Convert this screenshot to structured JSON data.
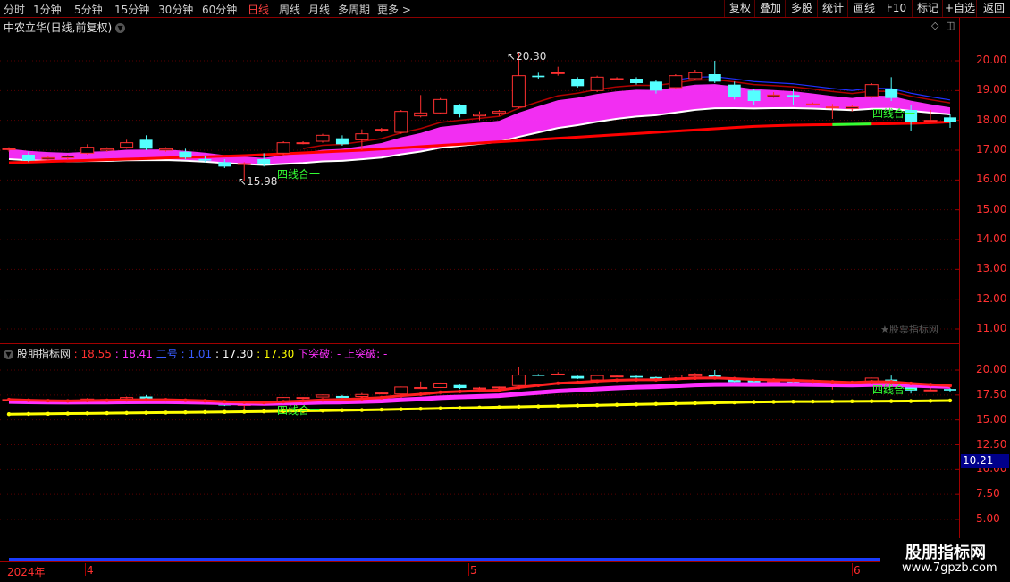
{
  "toolbar": {
    "periods": [
      "分时",
      "1分钟",
      "5分钟",
      "15分钟",
      "30分钟",
      "60分钟",
      "日线",
      "周线",
      "月线",
      "多周期",
      "更多 >"
    ],
    "active_period": "日线",
    "buttons": [
      "复权",
      "叠加",
      "多股",
      "统计",
      "画线",
      "F10",
      "标记",
      "+自选",
      "返回"
    ]
  },
  "main_panel": {
    "title": "中农立华(日线,前复权)",
    "high_label": "20.30",
    "low_label": "15.98",
    "annotation1": "四线合一",
    "annotation2": "四线合一",
    "watermark": "★股票指标网",
    "y_ticks": [
      "20.00",
      "19.00",
      "18.00",
      "17.00",
      "16.00",
      "15.00",
      "14.00",
      "13.00",
      "12.00",
      "11.00"
    ]
  },
  "sub_panel": {
    "name": "股朋指标网",
    "v1": ": 18.55",
    "v2": ": 18.41",
    "v3_label": "二号",
    "v3": ": 1.01",
    "v4": ": 17.30",
    "v5": ": 17.30",
    "down_break": "下突破: -",
    "up_break": "上突破: -",
    "annotation1": "四线合一",
    "annotation2": "四线合一",
    "y_ticks": [
      "20.00",
      "17.50",
      "15.00",
      "12.50",
      "10.00",
      "7.50",
      "5.00"
    ],
    "value_box": "10.21"
  },
  "time_axis": {
    "labels": [
      "2024年",
      "4",
      "5",
      "6"
    ]
  },
  "brand": {
    "name": "股朋指标网",
    "url": "www.7gpzb.com"
  },
  "colors": {
    "up": "#ff3030",
    "down": "#54ffff",
    "ma_long": "#ff0000",
    "band": "#ff30ff",
    "white_line": "#ffffff",
    "yellow_line": "#ffff00",
    "accent_green": "#33ff33"
  },
  "chart_data": {
    "type": "candlestick",
    "title": "中农立华(日线,前复权)",
    "ylim": [
      10.5,
      20.6
    ],
    "candles": [
      [
        17.05,
        17.1,
        16.95,
        17.05
      ],
      [
        16.85,
        16.95,
        16.6,
        16.65
      ],
      [
        16.7,
        16.8,
        16.65,
        16.75
      ],
      [
        16.75,
        16.85,
        16.7,
        16.8
      ],
      [
        16.9,
        17.2,
        16.85,
        17.1
      ],
      [
        17.0,
        17.1,
        16.95,
        17.05
      ],
      [
        17.1,
        17.35,
        17.05,
        17.25
      ],
      [
        17.35,
        17.5,
        17.0,
        17.05
      ],
      [
        17.0,
        17.1,
        16.95,
        17.05
      ],
      [
        16.95,
        17.05,
        16.7,
        16.75
      ],
      [
        16.7,
        16.8,
        16.6,
        16.65
      ],
      [
        16.6,
        16.7,
        16.4,
        16.45
      ],
      [
        16.55,
        16.6,
        15.98,
        16.55
      ],
      [
        16.7,
        16.9,
        16.45,
        16.55
      ],
      [
        16.9,
        17.3,
        16.8,
        17.25
      ],
      [
        17.25,
        17.3,
        17.2,
        17.25
      ],
      [
        17.3,
        17.55,
        17.25,
        17.5
      ],
      [
        17.4,
        17.5,
        17.15,
        17.2
      ],
      [
        17.35,
        17.7,
        17.0,
        17.55
      ],
      [
        17.7,
        17.75,
        17.6,
        17.7
      ],
      [
        17.6,
        18.35,
        17.55,
        18.3
      ],
      [
        18.15,
        18.85,
        18.1,
        18.25
      ],
      [
        18.25,
        18.75,
        18.2,
        18.7
      ],
      [
        18.5,
        18.55,
        18.1,
        18.2
      ],
      [
        18.15,
        18.3,
        18.0,
        18.2
      ],
      [
        18.25,
        18.35,
        18.15,
        18.3
      ],
      [
        18.45,
        20.3,
        18.4,
        19.5
      ],
      [
        19.5,
        19.6,
        19.4,
        19.45
      ],
      [
        19.6,
        19.8,
        19.5,
        19.6
      ],
      [
        19.4,
        19.45,
        19.1,
        19.15
      ],
      [
        19.0,
        19.5,
        18.95,
        19.45
      ],
      [
        19.4,
        19.45,
        19.35,
        19.4
      ],
      [
        19.4,
        19.45,
        19.2,
        19.25
      ],
      [
        19.3,
        19.35,
        18.9,
        19.0
      ],
      [
        19.1,
        19.55,
        19.05,
        19.5
      ],
      [
        19.4,
        19.7,
        19.35,
        19.6
      ],
      [
        19.55,
        20.0,
        19.25,
        19.3
      ],
      [
        19.2,
        19.3,
        18.7,
        18.8
      ],
      [
        19.0,
        19.05,
        18.5,
        18.65
      ],
      [
        18.8,
        18.95,
        18.75,
        18.85
      ],
      [
        18.85,
        19.05,
        18.5,
        18.8
      ],
      [
        18.55,
        18.6,
        18.5,
        18.55
      ],
      [
        18.45,
        18.55,
        18.05,
        18.45
      ],
      [
        18.4,
        18.5,
        18.3,
        18.45
      ],
      [
        18.8,
        19.25,
        18.75,
        19.2
      ],
      [
        19.05,
        19.45,
        18.65,
        18.75
      ],
      [
        18.35,
        18.5,
        17.65,
        17.95
      ],
      [
        18.0,
        18.35,
        17.95,
        18.0
      ],
      [
        18.1,
        18.2,
        17.75,
        17.95
      ]
    ],
    "ma_long": [
      16.58,
      16.6,
      16.62,
      16.64,
      16.66,
      16.68,
      16.7,
      16.72,
      16.74,
      16.76,
      16.78,
      16.8,
      16.82,
      16.85,
      16.88,
      16.91,
      16.94,
      16.97,
      17.0,
      17.04,
      17.08,
      17.12,
      17.16,
      17.2,
      17.24,
      17.28,
      17.32,
      17.36,
      17.4,
      17.44,
      17.48,
      17.52,
      17.56,
      17.6,
      17.64,
      17.68,
      17.72,
      17.76,
      17.8,
      17.82,
      17.84,
      17.85,
      17.86,
      17.87,
      17.88,
      17.89,
      17.9,
      17.92,
      17.95
    ]
  }
}
